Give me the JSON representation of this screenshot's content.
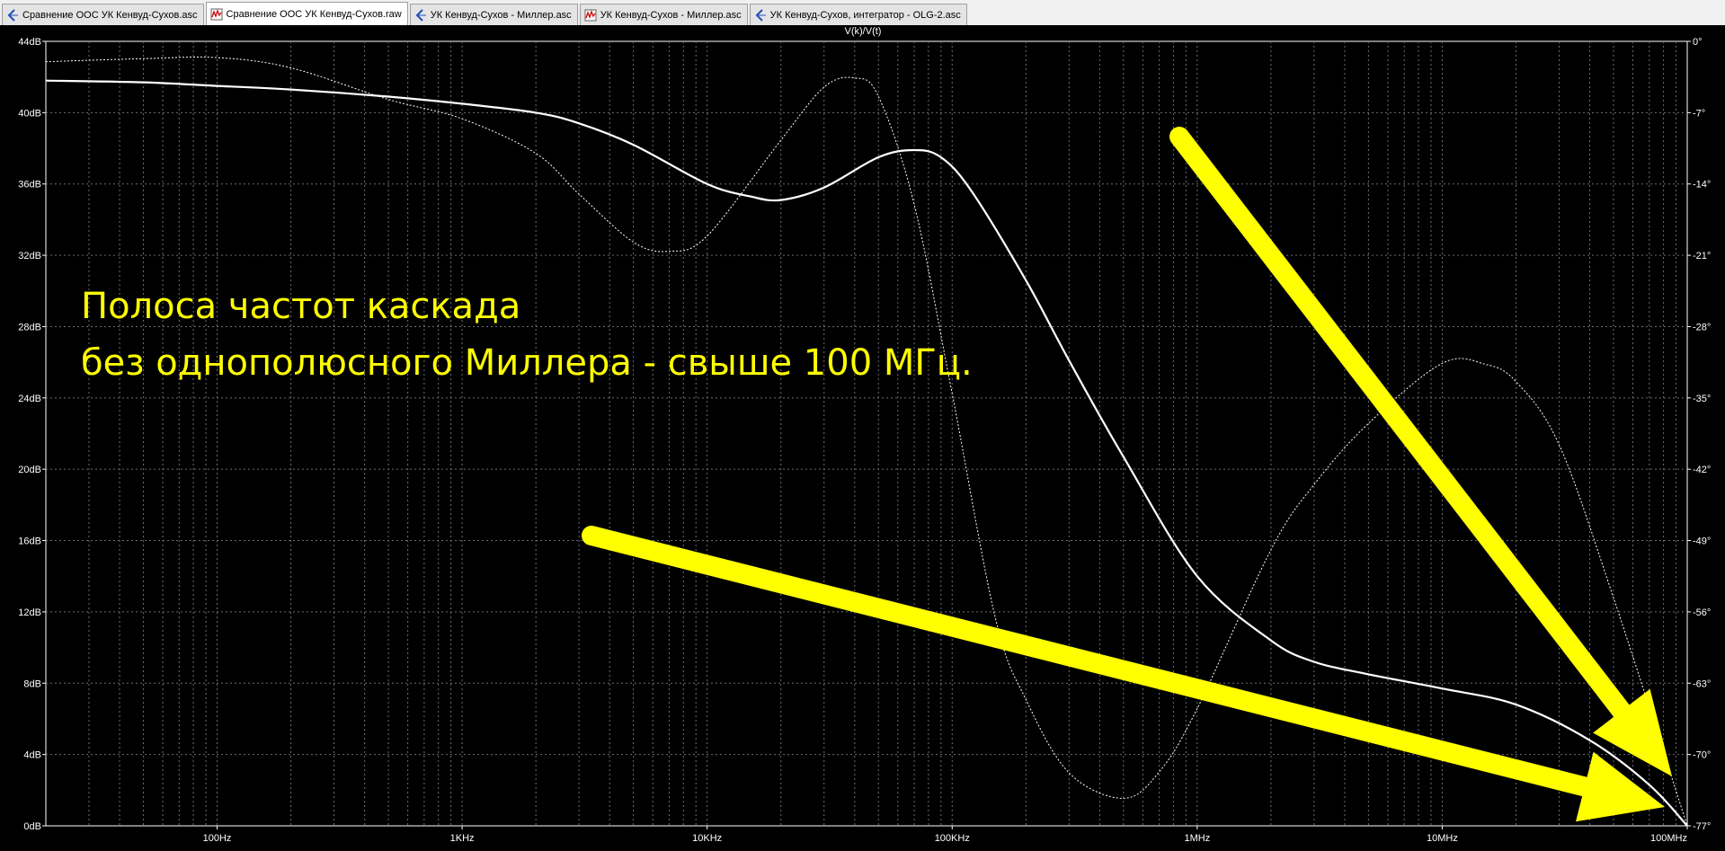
{
  "tabs": [
    {
      "label": "Сравнение ООС УК Кенвуд-Сухов.asc",
      "icon": "schematic-icon",
      "active": false
    },
    {
      "label": "Сравнение ООС УК Кенвуд-Сухов.raw",
      "icon": "waveform-icon",
      "active": true
    },
    {
      "label": "УК Кенвуд-Сухов - Миллер.asc",
      "icon": "schematic-icon",
      "active": false
    },
    {
      "label": "УК Кенвуд-Сухов - Миллер.asc",
      "icon": "waveform-icon",
      "active": false
    },
    {
      "label": "УК Кенвуд-Сухов, интегратор - OLG-2.asc",
      "icon": "schematic-icon",
      "active": false
    }
  ],
  "colors": {
    "plot_bg": "#000000",
    "trace": "#ffffff",
    "annotation": "#ffff00",
    "grid": "#6e6e6e"
  },
  "annotation": {
    "line1": "Полоса частот каскада",
    "line2": "без однополюсного Миллера - свыше 100 МГц."
  },
  "chart_data": {
    "type": "line",
    "title": "V(k)/V(t)",
    "x_scale": "log",
    "xlim": [
      20,
      100000000
    ],
    "x_ticks": [
      {
        "value": 100,
        "label": "100Hz"
      },
      {
        "value": 1000,
        "label": "1KHz"
      },
      {
        "value": 10000,
        "label": "10KHz"
      },
      {
        "value": 100000,
        "label": "100KHz"
      },
      {
        "value": 1000000,
        "label": "1MHz"
      },
      {
        "value": 10000000,
        "label": "10MHz"
      },
      {
        "value": 100000000,
        "label": "100MHz"
      }
    ],
    "ylim_left": [
      0,
      44
    ],
    "y_left_ticks": [
      "0dB",
      "4dB",
      "8dB",
      "12dB",
      "16dB",
      "20dB",
      "24dB",
      "28dB",
      "32dB",
      "36dB",
      "40dB",
      "44dB"
    ],
    "ylim_right": [
      -77,
      0
    ],
    "y_right_ticks": [
      "-77°",
      "-70°",
      "-63°",
      "-56°",
      "-49°",
      "-42°",
      "-35°",
      "-28°",
      "-21°",
      "-14°",
      "-7°",
      "0°"
    ],
    "grid": true,
    "series": [
      {
        "axis": "left",
        "style": "solid",
        "x": [
          20,
          50,
          100,
          200,
          500,
          1000,
          2000,
          3000,
          5000,
          10000,
          15000,
          20000,
          30000,
          50000,
          70000,
          90000,
          120000,
          200000,
          300000,
          500000,
          1000000,
          2000000,
          3000000,
          5000000,
          10000000,
          20000000,
          40000000,
          70000000,
          100000000
        ],
        "y": [
          41.8,
          41.7,
          41.5,
          41.3,
          40.9,
          40.5,
          40.0,
          39.4,
          38.2,
          36.0,
          35.3,
          35.1,
          35.8,
          37.5,
          37.9,
          37.5,
          35.6,
          30.6,
          26.1,
          20.7,
          14.0,
          10.4,
          9.2,
          8.5,
          7.7,
          6.8,
          4.8,
          2.3,
          0.0
        ]
      },
      {
        "axis": "right",
        "style": "dotted",
        "x": [
          20,
          50,
          100,
          200,
          500,
          1000,
          2000,
          3000,
          5000,
          7000,
          10000,
          20000,
          30000,
          40000,
          50000,
          70000,
          100000,
          150000,
          200000,
          300000,
          500000,
          700000,
          1000000,
          2000000,
          3000000,
          5000000,
          10000000,
          15000000,
          20000000,
          30000000,
          50000000,
          100000000
        ],
        "y": [
          -2.0,
          -1.7,
          -1.6,
          -2.6,
          -5.7,
          -7.6,
          -11.0,
          -15.0,
          -19.7,
          -20.6,
          -19.1,
          -9.7,
          -4.5,
          -3.6,
          -5.4,
          -16.0,
          -34.6,
          -56.6,
          -64.6,
          -71.8,
          -74.3,
          -71.7,
          -65.5,
          -49.9,
          -43.5,
          -37.5,
          -31.6,
          -31.7,
          -33.4,
          -39.6,
          -54.6,
          -77.0
        ]
      }
    ]
  }
}
